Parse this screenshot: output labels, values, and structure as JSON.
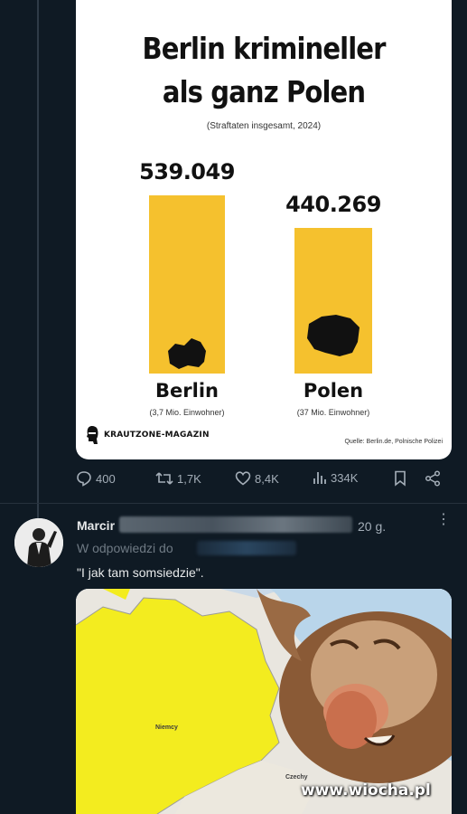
{
  "card": {
    "title_line1": "Berlin krimineller",
    "title_line2": "als ganz Polen",
    "subtitle": "(Straftaten insgesamt, 2024)",
    "brand": "KRAUTZONE-MAGAZIN",
    "source": "Quelle: Berlin.de, Polnische Polizei"
  },
  "chart_data": {
    "type": "bar",
    "title": "Berlin krimineller als ganz Polen",
    "subtitle": "(Straftaten insgesamt, 2024)",
    "categories": [
      "Berlin",
      "Polen"
    ],
    "category_notes": [
      "(3,7 Mio. Einwohner)",
      "(37 Mio. Einwohner)"
    ],
    "values": [
      539049,
      440269
    ],
    "value_labels": [
      "539.049",
      "440.269"
    ],
    "bar_color": "#f5c12e",
    "ylim": [
      0,
      539049
    ]
  },
  "tweet_actions": {
    "replies": "400",
    "reposts": "1,7K",
    "likes": "8,4K",
    "views": "334K"
  },
  "reply": {
    "name": "Marcir",
    "time": "20 g.",
    "more": "⋮",
    "reply_to": "W odpowiedzi do",
    "text": "\"I jak tam somsiedzie\"."
  },
  "media": {
    "label_niemcy": "Niemcy",
    "label_czechy": "Czechy"
  },
  "watermark": "www.wiocha.pl",
  "colors": {
    "background": "#0f1a24",
    "accent_yellow": "#f5c12e",
    "muted_text": "#a4aeb8"
  }
}
